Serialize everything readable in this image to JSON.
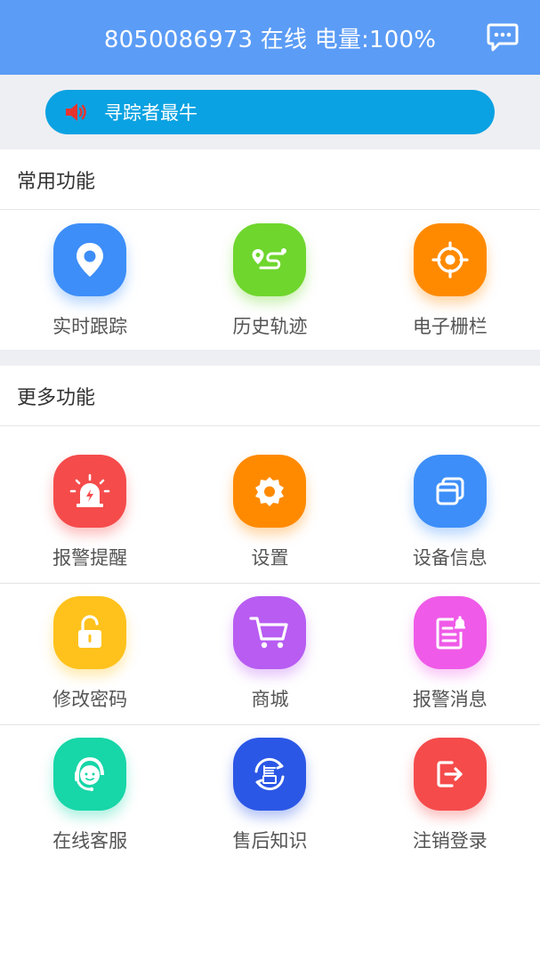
{
  "header": {
    "status_text": "8050086973 在线 电量:100%",
    "message_icon": "chat-bubble-icon",
    "background_color": "#5b9cf6"
  },
  "banner": {
    "text": "寻踪者最牛",
    "icon": "speaker-icon",
    "background_color": "#0aa2e2"
  },
  "sections": {
    "common": {
      "title": "常用功能",
      "items": [
        {
          "label": "实时跟踪",
          "icon": "location-pin-icon",
          "color": "#3d8ef8"
        },
        {
          "label": "历史轨迹",
          "icon": "route-icon",
          "color": "#6fd62d"
        },
        {
          "label": "电子栅栏",
          "icon": "target-icon",
          "color": "#ff8a00"
        }
      ]
    },
    "more": {
      "title": "更多功能",
      "items": [
        {
          "label": "报警提醒",
          "icon": "alarm-light-icon",
          "color": "#f54b4b"
        },
        {
          "label": "设置",
          "icon": "gear-icon",
          "color": "#ff8a00"
        },
        {
          "label": "设备信息",
          "icon": "windows-icon",
          "color": "#3d8ef8"
        },
        {
          "label": "修改密码",
          "icon": "unlock-icon",
          "color": "#ffc21c"
        },
        {
          "label": "商城",
          "icon": "shopping-cart-icon",
          "color": "#b85cf2"
        },
        {
          "label": "报警消息",
          "icon": "alert-document-icon",
          "color": "#ef5be8"
        },
        {
          "label": "在线客服",
          "icon": "customer-service-icon",
          "color": "#17d6a8"
        },
        {
          "label": "售后知识",
          "icon": "after-sales-icon",
          "color": "#2b57e6"
        },
        {
          "label": "注销登录",
          "icon": "logout-icon",
          "color": "#f54b4b"
        }
      ]
    }
  }
}
